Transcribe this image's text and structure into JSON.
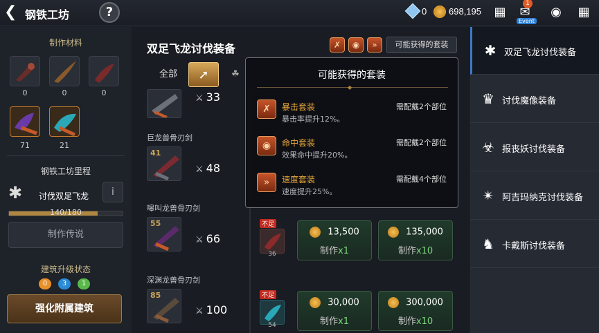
{
  "header": {
    "back_icon": "back-arrow-icon",
    "title": "钢铁工坊",
    "help_label": "?",
    "gems": "0",
    "gold": "698,195",
    "mail_badge": "1",
    "event_label": "Event"
  },
  "left": {
    "materials_title": "制作材料",
    "materials": [
      {
        "name": "beak-material",
        "count": "0"
      },
      {
        "name": "horn-material",
        "count": "0"
      },
      {
        "name": "claw-material",
        "count": "0"
      },
      {
        "name": "purple-claw-material",
        "count": "71"
      },
      {
        "name": "blue-claw-material",
        "count": "21"
      }
    ],
    "milestone_title": "钢铁工坊里程",
    "milestone_name": "讨伐双足飞龙",
    "info_label": "i",
    "progress_text": "140/180",
    "progress_fraction": 0.78,
    "legend_button": "制作传说",
    "upgrade_title": "建筑升级状态",
    "upgrade_levels": [
      "0",
      "3",
      "1"
    ],
    "upgrade_colors": [
      "#e8902a",
      "#2a8ad6",
      "#5ab84a"
    ],
    "enhance_button": "强化附属建筑"
  },
  "center": {
    "title": "双足飞龙讨伐装备",
    "set_icons": [
      "crit-set-icon",
      "hit-set-icon",
      "speed-set-icon"
    ],
    "possible_sets_button": "可能获得的套装",
    "tabs": [
      {
        "label": "全部"
      },
      {
        "label": "",
        "icon": "sword-icon"
      },
      {
        "label": "",
        "icon": "helmet-icon"
      }
    ],
    "items": [
      {
        "name": "",
        "level": "",
        "attack": "33"
      },
      {
        "name": "巨龙兽骨刃剑",
        "level": "41",
        "attack": "48"
      },
      {
        "name": "嗥叫龙兽骨刃剑",
        "level": "55",
        "attack": "66",
        "badge": "不足",
        "mat_count": "36",
        "cost1": "13,500",
        "label1": "制作",
        "mult1": "x1",
        "cost2": "135,000",
        "label2": "制作",
        "mult2": "x10"
      },
      {
        "name": "深渊龙兽骨刃剑",
        "level": "85",
        "attack": "100",
        "badge": "不足",
        "mat_count": "54",
        "cost1": "30,000",
        "label1": "制作",
        "mult1": "x1",
        "cost2": "300,000",
        "label2": "制作",
        "mult2": "x10"
      }
    ]
  },
  "popup": {
    "title": "可能获得的套装",
    "sets": [
      {
        "name": "暴击套装",
        "desc": "暴击率提升12%。",
        "req": "需配戴2个部位",
        "icon": "crit-set-icon"
      },
      {
        "name": "命中套装",
        "desc": "效果命中提升20%。",
        "req": "需配戴2个部位",
        "icon": "hit-set-icon"
      },
      {
        "name": "速度套装",
        "desc": "速度提升25%。",
        "req": "需配戴4个部位",
        "icon": "speed-set-icon"
      }
    ]
  },
  "right": {
    "items": [
      {
        "label": "双足飞龙讨伐装备",
        "icon": "wyvern-icon",
        "selected": true
      },
      {
        "label": "讨伐魔像装备",
        "icon": "golem-icon"
      },
      {
        "label": "报丧妖讨伐装备",
        "icon": "banshee-icon"
      },
      {
        "label": "阿吉玛纳克讨伐装备",
        "icon": "azimanak-icon"
      },
      {
        "label": "卡戴斯讨伐装备",
        "icon": "kades-icon"
      }
    ]
  }
}
